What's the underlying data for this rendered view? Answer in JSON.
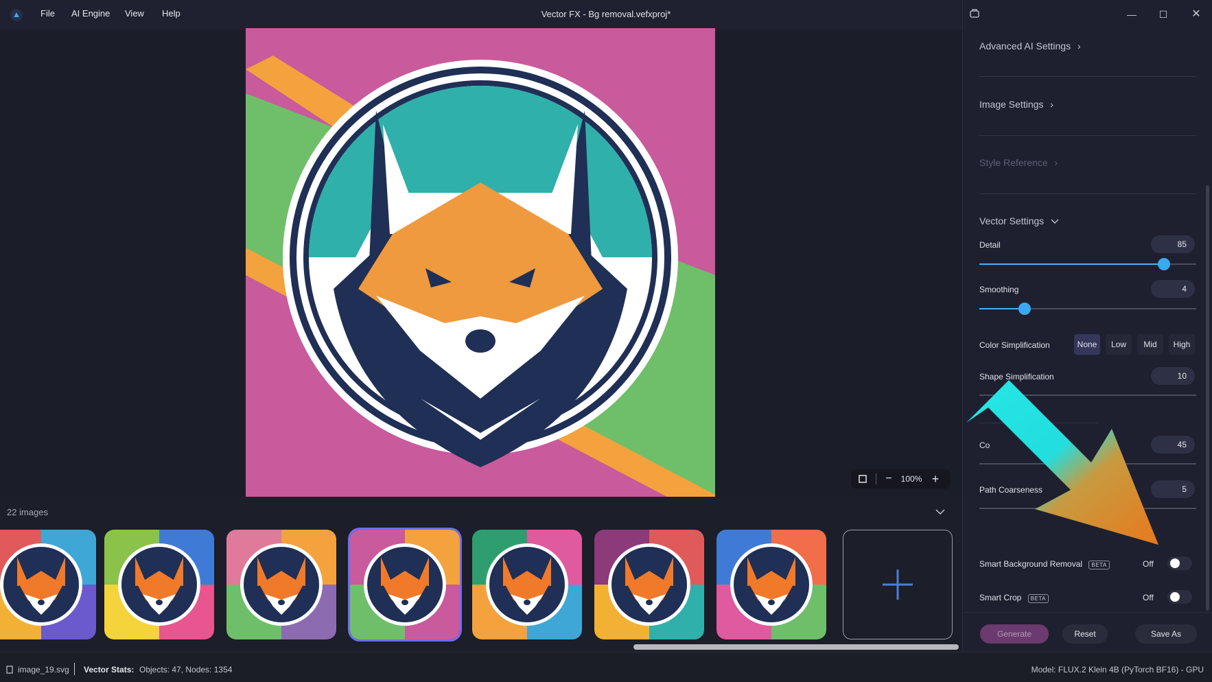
{
  "window": {
    "title": "Vector FX - Bg removal.vefxproj*",
    "menu": [
      "File",
      "AI Engine",
      "View",
      "Help"
    ]
  },
  "canvas": {
    "zoom": "100%"
  },
  "gallery": {
    "count_label": "22 images",
    "selected_index": 3
  },
  "panel": {
    "advanced_ai": "Advanced AI Settings",
    "image_settings": "Image Settings",
    "style_reference": "Style Reference",
    "vector_settings": "Vector Settings",
    "detail": {
      "label": "Detail",
      "value": "85",
      "fraction": 0.85
    },
    "smoothing": {
      "label": "Smoothing",
      "value": "4",
      "fraction": 0.21
    },
    "color_simplification": {
      "label": "Color Simplification",
      "options": [
        "None",
        "Low",
        "Mid",
        "High"
      ],
      "selected": "None"
    },
    "shape_simplification": {
      "label": "Shape Simplification",
      "value": "10"
    },
    "hidden_setting": {
      "label": "Co",
      "value": "45"
    },
    "path_coarseness": {
      "label": "Path Coarseness",
      "value": "5"
    },
    "smart_bg_removal": {
      "label": "Smart Background Removal",
      "badge": "BETA",
      "state": "Off"
    },
    "smart_crop": {
      "label": "Smart Crop",
      "badge": "BETA",
      "state": "Off"
    },
    "buttons": {
      "generate": "Generate",
      "reset": "Reset",
      "save_as": "Save As"
    }
  },
  "status": {
    "filename": "image_19.svg",
    "stats_label": "Vector Stats:",
    "stats": "Objects: 47, Nodes: 1354",
    "model": "Model: FLUX.2 Klein 4B (PyTorch BF16) - GPU"
  },
  "colors": {
    "accent_blue": "#3aa9f0",
    "generate_bg": "#6b3a6e",
    "annotation_cyan": "#25e6e6",
    "annotation_orange": "#e8791c"
  },
  "icons": [
    "app-logo-icon",
    "panel-icon",
    "minimize-icon",
    "maximize-icon",
    "close-icon",
    "fit-icon",
    "zoom-out-icon",
    "zoom-in-icon",
    "chevron-right-icon",
    "chevron-down-icon",
    "plus-icon",
    "file-icon"
  ]
}
